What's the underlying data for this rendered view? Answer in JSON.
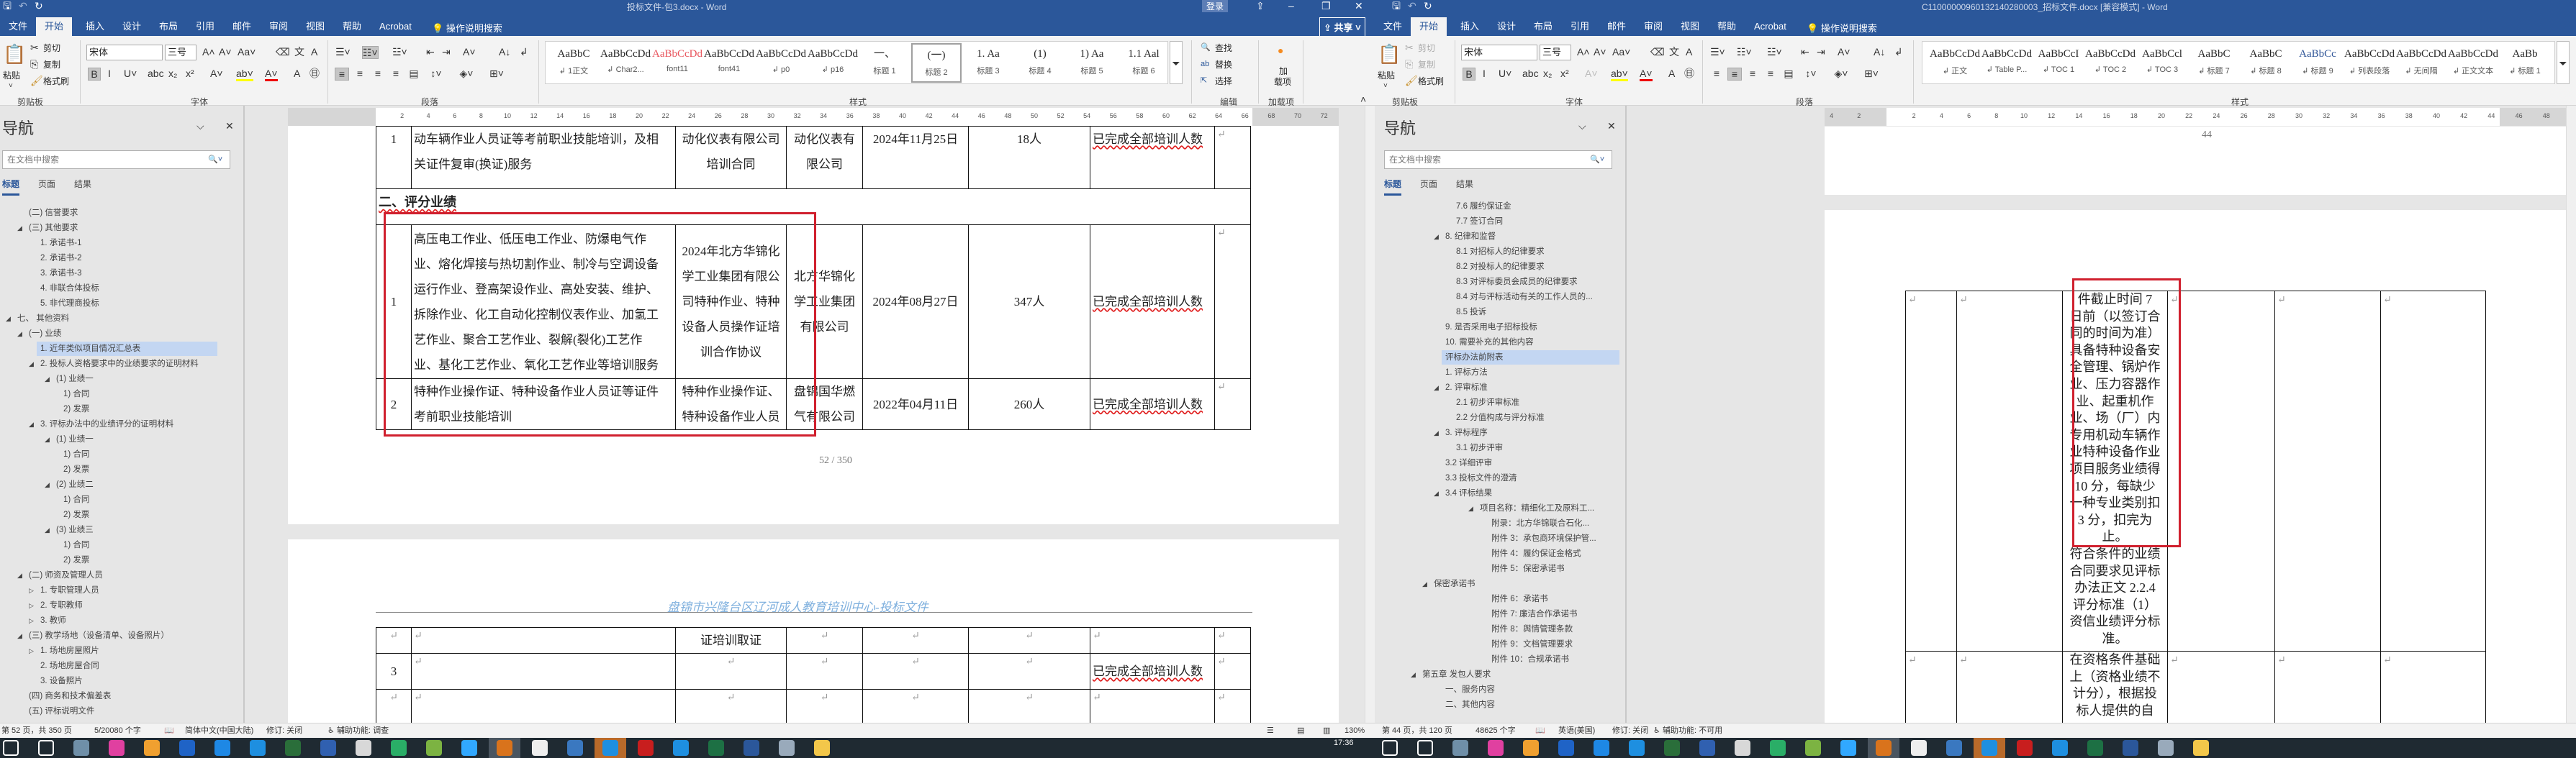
{
  "left_window": {
    "title": "投标文件-包3.docx  -  Word",
    "login_label": "登录",
    "share_label": "共享",
    "tabs": [
      "文件",
      "开始",
      "插入",
      "设计",
      "布局",
      "引用",
      "邮件",
      "审阅",
      "视图",
      "帮助",
      "Acrobat"
    ],
    "tell_me": "操作说明搜索",
    "ribbon": {
      "clipboard": {
        "paste": "粘贴",
        "cut": "剪切",
        "copy": "复制",
        "format_painter": "格式刷",
        "group": "剪贴板"
      },
      "font": {
        "name": "宋体",
        "size": "三号",
        "group": "字体"
      },
      "paragraph": {
        "group": "段落"
      },
      "styles": {
        "group": "样式",
        "items": [
          {
            "preview": "AaBbC",
            "label": "↲ 1正文"
          },
          {
            "preview": "AaBbCcDdI",
            "label": "↲ Char2..."
          },
          {
            "preview": "AaBbCcDdI",
            "label": "font11",
            "color": "#e8545c"
          },
          {
            "preview": "AaBbCcDdI",
            "label": "font41"
          },
          {
            "preview": "AaBbCcDd",
            "label": "↲ p0"
          },
          {
            "preview": "AaBbCcDd",
            "label": "↲ p16"
          },
          {
            "preview": "一、",
            "label": "标题 1"
          },
          {
            "preview": "(一)",
            "label": "标题 2",
            "selected": true
          },
          {
            "preview": "1.  Aa",
            "label": "标题 3"
          },
          {
            "preview": "(1)",
            "label": "标题 4"
          },
          {
            "preview": "1)  Aa",
            "label": "标题 5"
          },
          {
            "preview": "1.1  Aal",
            "label": "标题 6"
          }
        ]
      },
      "editing": {
        "find": "查找",
        "replace": "替换",
        "select": "选择",
        "group": "编辑"
      },
      "addins": {
        "line1": "加",
        "line2": "载项",
        "group": "加载项"
      }
    },
    "nav": {
      "title": "导航",
      "search_placeholder": "在文档中搜索",
      "tabs": [
        "标题",
        "页面",
        "结果"
      ],
      "items": [
        {
          "text": "(二) 信誉要求",
          "level": 1
        },
        {
          "text": "(三) 其他要求",
          "level": 1,
          "arrow": "open"
        },
        {
          "text": "1. 承诺书-1",
          "level": 2
        },
        {
          "text": "2. 承诺书-2",
          "level": 2
        },
        {
          "text": "3. 承诺书-3",
          "level": 2
        },
        {
          "text": "4. 非联合体投标",
          "level": 2
        },
        {
          "text": "5. 非代理商投标",
          "level": 2
        },
        {
          "text": "七、 其他资料",
          "level": 0,
          "arrow": "open"
        },
        {
          "text": "(一) 业绩",
          "level": 1,
          "arrow": "open"
        },
        {
          "text": "1. 近年类似项目情况汇总表",
          "level": 2,
          "selected": true
        },
        {
          "text": "2. 投标人资格要求中的业绩要求的证明材料",
          "level": 2,
          "arrow": "open"
        },
        {
          "text": "(1)   业绩一",
          "level": 3,
          "arrow": "open"
        },
        {
          "text": "1) 合同",
          "level": 4
        },
        {
          "text": "2) 发票",
          "level": 4
        },
        {
          "text": "3. 评标办法中的业绩评分的证明材料",
          "level": 2,
          "arrow": "open"
        },
        {
          "text": "(1)   业绩一",
          "level": 3,
          "arrow": "open"
        },
        {
          "text": "1) 合同",
          "level": 4
        },
        {
          "text": "2) 发票",
          "level": 4
        },
        {
          "text": "(2)   业绩二",
          "level": 3,
          "arrow": "open"
        },
        {
          "text": "1) 合同",
          "level": 4
        },
        {
          "text": "2) 发票",
          "level": 4
        },
        {
          "text": "(3)   业绩三",
          "level": 3,
          "arrow": "open"
        },
        {
          "text": "1) 合同",
          "level": 4
        },
        {
          "text": "2) 发票",
          "level": 4
        },
        {
          "text": "(二) 师资及管理人员",
          "level": 1,
          "arrow": "open"
        },
        {
          "text": "1. 专职管理人员",
          "level": 2,
          "arrow": "closed"
        },
        {
          "text": "2. 专职教师",
          "level": 2,
          "arrow": "closed"
        },
        {
          "text": "3. 教师",
          "level": 2,
          "arrow": "closed"
        },
        {
          "text": "(三) 教学场地（设备清单、设备照片）",
          "level": 1,
          "arrow": "open"
        },
        {
          "text": "1. 场地房屋照片",
          "level": 2,
          "arrow": "closed"
        },
        {
          "text": "2. 场地房屋合同",
          "level": 2
        },
        {
          "text": "3. 设备照片",
          "level": 2
        },
        {
          "text": "(四) 商务和技术偏差表",
          "level": 1
        },
        {
          "text": "(五) 评标说明文件",
          "level": 1
        }
      ]
    },
    "ruler_labels": [
      2,
      4,
      6,
      8,
      10,
      12,
      14,
      16,
      18,
      20,
      22,
      24,
      26,
      28,
      30,
      32,
      34,
      36,
      38,
      40,
      42,
      44,
      46,
      48,
      50,
      52,
      54,
      56,
      58,
      60,
      62,
      64,
      66,
      68,
      70,
      72
    ],
    "document": {
      "page_number": "52 / 350",
      "page2_header": "盘锦市兴隆台区辽河成人教育培训中心-投标文件",
      "section_heading": "二、评分业绩",
      "rows_page1": [
        [
          [
            "1"
          ],
          [
            "动车辆作业人员证等考前职业技能培训，及相",
            "关证件复审(换证)服务"
          ],
          [
            "动化仪表有限公司",
            "培训合同"
          ],
          [
            "动化仪表有",
            "限公司"
          ],
          [
            "2024年11月25日"
          ],
          [
            "18人"
          ],
          [
            "已完成全部培训人数"
          ],
          []
        ],
        [
          [
            "1"
          ],
          [
            "高压电工作业、低压电工作业、防爆电气作",
            "业、熔化焊接与热切割作业、制冷与空调设备",
            "运行作业、登高架设作业、高处安装、维护、",
            "拆除作业、化工自动化控制仪表作业、加氢工",
            "艺作业、聚合工艺作业、裂解(裂化)工艺作",
            "业、基化工艺作业、氧化工艺作业等培训服务"
          ],
          [
            "2024年北方华锦化",
            "学工业集团有限公",
            "司特种作业、特种",
            "设备人员操作证培",
            "训合作协议"
          ],
          [
            "北方华锦化",
            "学工业集团",
            "有限公司"
          ],
          [
            "2024年08月27日"
          ],
          [
            "347人"
          ],
          [
            "已完成全部培训人数"
          ],
          []
        ],
        [
          [
            "2"
          ],
          [
            "特种作业操作证、特种设备作业人员证等证件",
            "考前职业技能培训"
          ],
          [
            "特种作业操作证、",
            "特种设备作业人员"
          ],
          [
            "盘锦国华燃",
            "气有限公司"
          ],
          [
            "2022年04月11日"
          ],
          [
            "260人"
          ],
          [
            "已完成全部培训人数"
          ],
          []
        ]
      ],
      "rows_page2": [
        [
          [],
          [],
          [
            "证培训取证"
          ],
          [],
          [],
          [],
          [],
          []
        ],
        [
          [
            "3"
          ],
          [],
          [],
          [],
          [],
          [],
          [
            "已完成全部培训人数"
          ],
          []
        ],
        [
          [],
          [],
          [],
          [],
          [],
          [],
          [],
          []
        ]
      ]
    },
    "status": {
      "page": "第 52 页，共 350 页",
      "words": "5/20080 个字",
      "language": "简体中文(中国大陆)",
      "track": "修订: 关闭",
      "accessibility": "辅助功能: 调查",
      "zoom": "130%"
    }
  },
  "right_window": {
    "title": "C11000000960132140280003_招标文件.docx [兼容模式]  -  Word",
    "tabs": [
      "文件",
      "开始",
      "插入",
      "设计",
      "布局",
      "引用",
      "邮件",
      "审阅",
      "视图",
      "帮助",
      "Acrobat"
    ],
    "tell_me": "操作说明搜索",
    "ribbon": {
      "clipboard": {
        "paste": "粘贴",
        "cut": "剪切",
        "copy": "复制",
        "format_painter": "格式刷",
        "group": "剪贴板"
      },
      "font": {
        "name": "宋体",
        "size": "三号",
        "group": "字体"
      },
      "paragraph": {
        "group": "段落"
      },
      "styles": {
        "group": "样式",
        "items": [
          {
            "preview": "AaBbCcDd",
            "label": "↲ 正文"
          },
          {
            "preview": "AaBbCcDd",
            "label": "↲ Table P..."
          },
          {
            "preview": "AaBbCcI",
            "label": "↲ TOC 1"
          },
          {
            "preview": "AaBbCcDd",
            "label": "↲ TOC 2"
          },
          {
            "preview": "AaBbCcl",
            "label": "↲ TOC 3"
          },
          {
            "preview": "AaBbC",
            "label": "↲ 标题 7"
          },
          {
            "preview": "AaBbC",
            "label": "↲ 标题 8"
          },
          {
            "preview": "AaBbCc",
            "label": "↲ 标题 9",
            "color": "#2f5597"
          },
          {
            "preview": "AaBbCcDd",
            "label": "↲ 列表段落"
          },
          {
            "preview": "AaBbCcDd",
            "label": "↲ 无间隔"
          },
          {
            "preview": "AaBbCcDd",
            "label": "↲ 正文文本"
          },
          {
            "preview": "AaBb",
            "label": "↲ 标题 1"
          }
        ]
      }
    },
    "nav": {
      "title": "导航",
      "search_placeholder": "在文档中搜索",
      "tabs": [
        "标题",
        "页面",
        "结果"
      ],
      "items": [
        {
          "text": "7.6 履约保证金",
          "level": 3
        },
        {
          "text": "7.7 签订合同",
          "level": 3
        },
        {
          "text": "8. 纪律和监督",
          "level": 2,
          "arrow": "open"
        },
        {
          "text": "8.1 对招标人的纪律要求",
          "level": 3
        },
        {
          "text": "8.2 对投标人的纪律要求",
          "level": 3
        },
        {
          "text": "8.3 对评标委员会成员的纪律要求",
          "level": 3
        },
        {
          "text": "8.4 对与评标活动有关的工作人员的...",
          "level": 3
        },
        {
          "text": "8.5 投诉",
          "level": 3
        },
        {
          "text": "9. 是否采用电子招标投标",
          "level": 2
        },
        {
          "text": "10. 需要补充的其他内容",
          "level": 2
        },
        {
          "text": "评标办法前附表",
          "level": 2,
          "selected": true
        },
        {
          "text": "1. 评标方法",
          "level": 2
        },
        {
          "text": "2. 评审标准",
          "level": 2,
          "arrow": "open"
        },
        {
          "text": "2.1 初步评审标准",
          "level": 3
        },
        {
          "text": "2.2 分值构成与评分标准",
          "level": 3
        },
        {
          "text": "3. 评标程序",
          "level": 2,
          "arrow": "open"
        },
        {
          "text": "3.1 初步评审",
          "level": 3
        },
        {
          "text": "3.2 详细评审",
          "level": 2
        },
        {
          "text": "3.3 投标文件的澄清",
          "level": 2
        },
        {
          "text": "3.4 评标结果",
          "level": 2,
          "arrow": "open"
        },
        {
          "text": "项目名称：精细化工及原料工...",
          "level": 4,
          "arrow": "open"
        },
        {
          "text": "附录：北方华锦联合石化...",
          "level": 5
        },
        {
          "text": "附件 3：承包商环境保护管...",
          "level": 5
        },
        {
          "text": "附件 4：履约保证金格式",
          "level": 5
        },
        {
          "text": "附件 5：保密承诺书",
          "level": 5
        },
        {
          "text": "保密承诺书",
          "level": 1,
          "arrow": "open"
        },
        {
          "text": "附件 6：承诺书",
          "level": 5
        },
        {
          "text": "附件 7: 廉洁合作承诺书",
          "level": 5
        },
        {
          "text": "附件 8：舆情管理条款",
          "level": 5
        },
        {
          "text": "附件 9：文档管理要求",
          "level": 5
        },
        {
          "text": "附件 10：合规承诺书",
          "level": 5
        },
        {
          "text": "第五章 发包人要求",
          "level": 0,
          "arrow": "open"
        },
        {
          "text": "一、服务内容",
          "level": 2
        },
        {
          "text": "二、其他内容",
          "level": 2
        }
      ]
    },
    "ruler_labels": [
      4,
      2,
      2,
      4,
      6,
      8,
      10,
      12,
      14,
      16,
      18,
      20,
      22,
      24,
      26,
      28,
      30,
      32,
      34,
      36,
      38,
      40,
      42,
      44,
      46,
      48
    ],
    "document": {
      "page_number": "44",
      "rows": [
        [
          [],
          [],
          [
            "件截止时间 7",
            "日前（以签订合",
            "同的时间为准）",
            "具备特种设备安",
            "全管理、锅炉作",
            "业、压力容器作",
            "业、起重机作",
            "业、场（厂）内",
            "专用机动车辆作",
            "业特种设备作业",
            "项目服务业绩得",
            "10 分，每缺少",
            "一种专业类别扣",
            "3 分，扣完为",
            "止。",
            "符合条件的业绩",
            "合同要求见评标",
            "办法正文 2.2.4",
            "评分标准（1）",
            "资信业绩评分标",
            "准。"
          ],
          [],
          [],
          []
        ],
        [
          [],
          [],
          [
            "在资格条件基础",
            "上（资格业绩不",
            "计分），根据投",
            "标人提供的自"
          ],
          [],
          [],
          []
        ]
      ]
    },
    "status": {
      "page": "第 44 页，共 120 页",
      "words": "48625 个字",
      "language": "英语(美国)",
      "track": "修订: 关闭",
      "accessibility": "辅助功能: 不可用"
    }
  },
  "taskbar": {
    "clock": "17:36",
    "icons": [
      {
        "name": "windows-start",
        "color": "#ffffff"
      },
      {
        "name": "search",
        "color": "#ffffff"
      },
      {
        "name": "calculator",
        "color": "#6f8fa8"
      },
      {
        "name": "color-wheel-app",
        "color": "#e040a0"
      },
      {
        "name": "photo-app",
        "color": "#f0a030"
      },
      {
        "name": "dots-app",
        "color": "#1f63c6"
      },
      {
        "name": "blue-app",
        "color": "#1e88e5"
      },
      {
        "name": "browser-app",
        "color": "#1e8fe0"
      },
      {
        "name": "green-dark-app",
        "color": "#2a6e3a"
      },
      {
        "name": "globe-app",
        "color": "#3060b0"
      },
      {
        "name": "flashlight-app",
        "color": "#d8d8d8"
      },
      {
        "name": "wechat",
        "color": "#2aae67"
      },
      {
        "name": "green-circle-app",
        "color": "#7cb342"
      },
      {
        "name": "photoshop",
        "color": "#31a8ff"
      },
      {
        "name": "leaf-app",
        "color": "#d9731c",
        "highlight": "#4a5560"
      },
      {
        "name": "qq",
        "color": "#eeeeee"
      },
      {
        "name": "xn-app",
        "color": "#3a78c0"
      },
      {
        "name": "blue-circle-app",
        "color": "#1e8fe0",
        "highlight": "#b86a2a"
      },
      {
        "name": "acrobat",
        "color": "#c81e1e"
      },
      {
        "name": "edge-app",
        "color": "#1e8fe0"
      },
      {
        "name": "excel",
        "color": "#1d7044"
      },
      {
        "name": "word",
        "color": "#2b579a"
      },
      {
        "name": "glass-app",
        "color": "#9ab"
      },
      {
        "name": "file-explorer",
        "color": "#f3c74a"
      }
    ]
  },
  "colors": {
    "title_blue": "#2b579a",
    "red_box": "#d0202e",
    "nav_selected": "#c3d6f2",
    "header_blue": "#7fb0de"
  }
}
